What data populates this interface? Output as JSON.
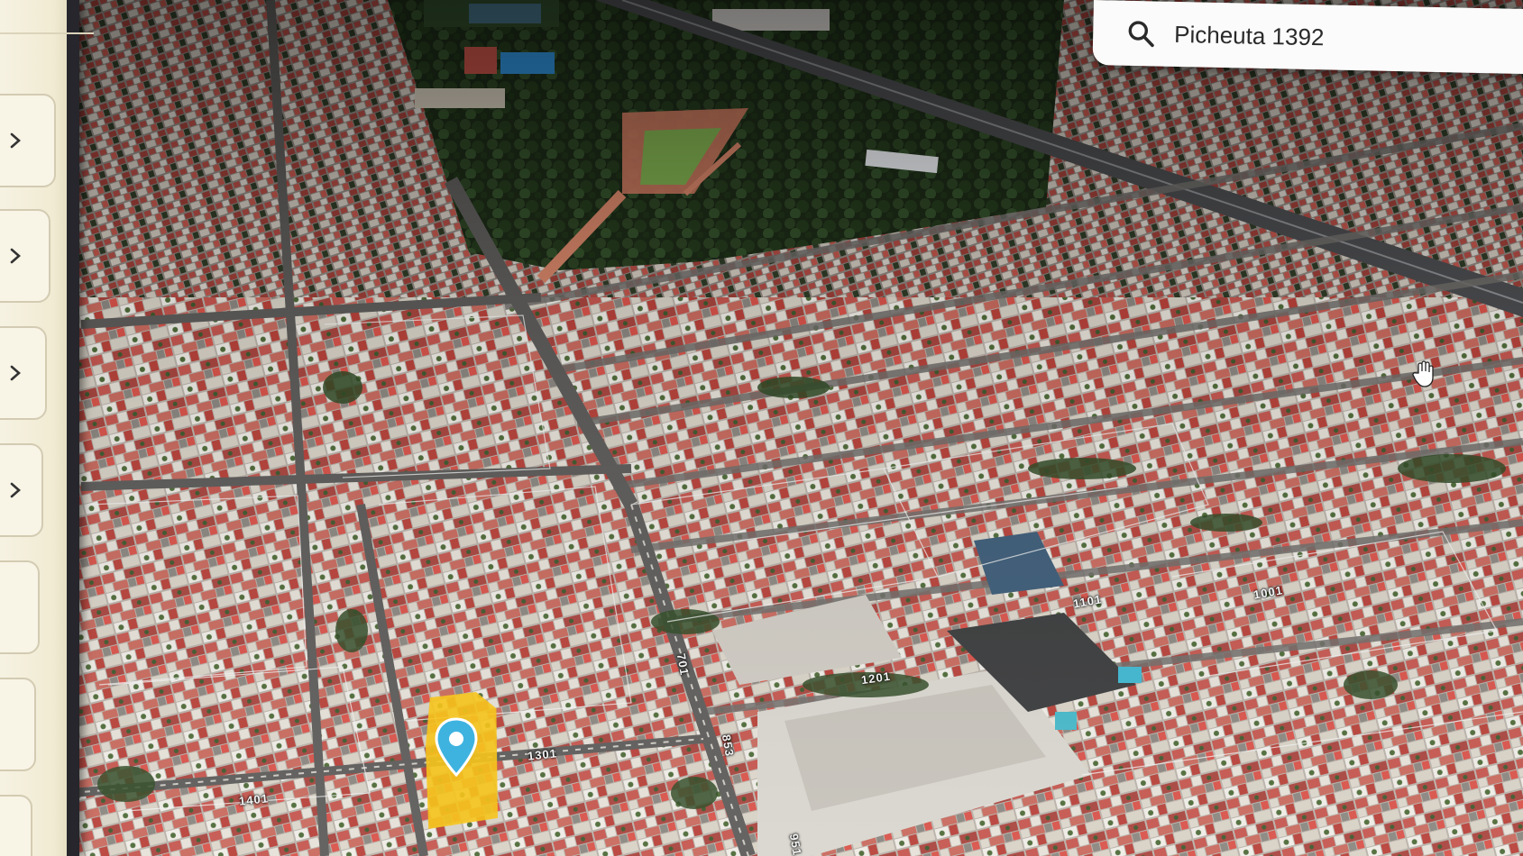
{
  "search": {
    "value": "Picheuta 1392",
    "icon": "search-icon"
  },
  "side_panel": {
    "cards": [
      {
        "icon": "chevron-right-icon"
      },
      {
        "icon": "chevron-right-icon"
      },
      {
        "icon": "chevron-right-icon"
      },
      {
        "icon": "chevron-right-icon"
      },
      {
        "icon": "chevron-right-icon"
      },
      {
        "icon": "chevron-right-icon"
      },
      {
        "icon": "chevron-right-icon"
      }
    ]
  },
  "map": {
    "type": "satellite-3d",
    "selected_parcel_color": "#f6c41c",
    "pin_color": "#3fb3e0",
    "street_labels": [
      "1401",
      "1301",
      "1201",
      "1101",
      "1001",
      "951",
      "853",
      "701"
    ]
  },
  "colors": {
    "panel_bg": "#f3eed8",
    "search_bg": "#fbfbfb",
    "text": "#2a2a2a"
  }
}
